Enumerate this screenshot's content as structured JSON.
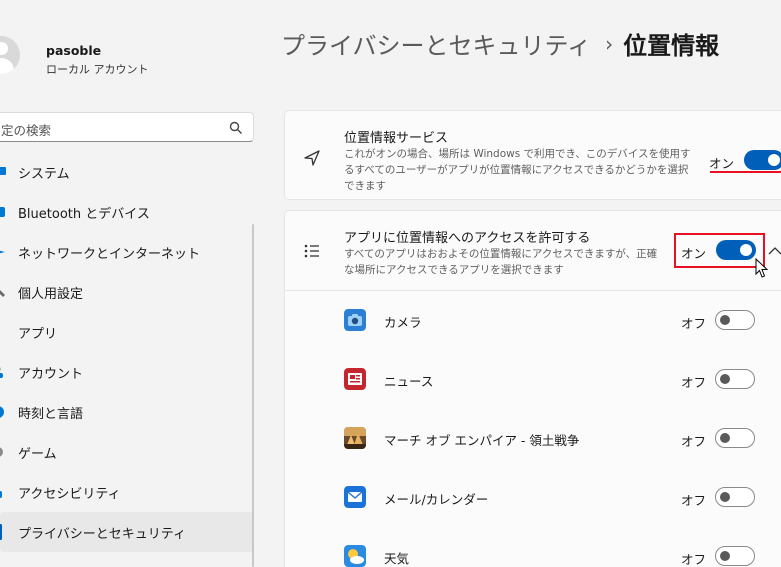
{
  "user": {
    "name": "pasoble",
    "account_type": "ローカル アカウント"
  },
  "search": {
    "text": "定の検索"
  },
  "nav": {
    "items": [
      {
        "label": "システム",
        "icon": "monitor-icon",
        "color": "#0078d4"
      },
      {
        "label": "Bluetooth とデバイス",
        "icon": "bluetooth-icon",
        "color": "#0078d4"
      },
      {
        "label": "ネットワークとインターネット",
        "icon": "wifi-icon",
        "color": "#0078d4"
      },
      {
        "label": "個人用設定",
        "icon": "brush-icon",
        "color": "#6b6b6b"
      },
      {
        "label": "アプリ",
        "icon": "apps-icon",
        "color": "#6b6b6b"
      },
      {
        "label": "アカウント",
        "icon": "person-icon",
        "color": "#2ea043"
      },
      {
        "label": "時刻と言語",
        "icon": "clock-icon",
        "color": "#0078d4"
      },
      {
        "label": "ゲーム",
        "icon": "gamepad-icon",
        "color": "#6b6b6b"
      },
      {
        "label": "アクセシビリティ",
        "icon": "accessibility-icon",
        "color": "#0078d4"
      },
      {
        "label": "プライバシーとセキュリティ",
        "icon": "shield-icon",
        "color": "#6b6b6b",
        "selected": true
      }
    ]
  },
  "breadcrumb": {
    "parent": "プライバシーとセキュリティ",
    "separator": "›",
    "current": "位置情報"
  },
  "location_service": {
    "title": "位置情報サービス",
    "description": "これがオンの場合、場所は Windows で利用でき、このデバイスを使用するすべてのユーザーがアプリが位置情報にアクセスできるかどうかを選択できます",
    "state_label": "オン",
    "on": true
  },
  "app_access": {
    "title": "アプリに位置情報へのアクセスを許可する",
    "description": "すべてのアプリはおおよその位置情報にアクセスできますが、正確な場所にアクセスできるアプリを選択できます",
    "state_label": "オン",
    "on": true
  },
  "apps": [
    {
      "name": "カメラ",
      "state_label": "オフ",
      "on": false,
      "icon": "camera-app-icon"
    },
    {
      "name": "ニュース",
      "state_label": "オフ",
      "on": false,
      "icon": "news-app-icon"
    },
    {
      "name": "マーチ オブ エンパイア - 領土戦争",
      "state_label": "オフ",
      "on": false,
      "icon": "game-app-icon"
    },
    {
      "name": "メール/カレンダー",
      "state_label": "オフ",
      "on": false,
      "icon": "mail-app-icon"
    },
    {
      "name": "天気",
      "state_label": "オフ",
      "on": false,
      "icon": "weather-app-icon"
    }
  ],
  "colors": {
    "accent": "#005fb8",
    "highlight": "#e81123"
  }
}
